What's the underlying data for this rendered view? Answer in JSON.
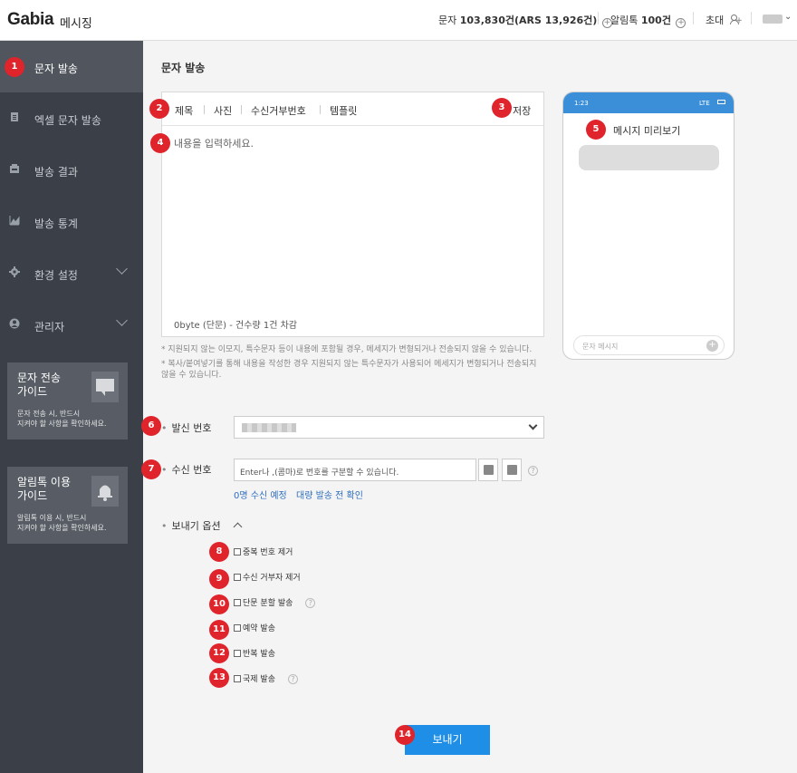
{
  "header": {
    "logo": "Gabia",
    "logo_sub": "메시징",
    "sms_label": "문자",
    "sms_value": "103,830건(ARS 13,926건)",
    "alimtalk_label": "알림톡",
    "alimtalk_value": "100건",
    "invite_label": "초대"
  },
  "sidebar": {
    "items": [
      {
        "label": "문자 발송"
      },
      {
        "label": "엑셀 문자 발송"
      },
      {
        "label": "발송 결과"
      },
      {
        "label": "발송 통계"
      },
      {
        "label": "환경 설정"
      },
      {
        "label": "관리자"
      }
    ],
    "guides": [
      {
        "title": "문자 전송\n가이드",
        "desc": "문자 전송 시, 반드시\n지켜야 할 사항을 확인하세요."
      },
      {
        "title": "알림톡 이용\n가이드",
        "desc": "알림톡 이용 시, 반드시\n지켜야 할 사항을 확인하세요."
      }
    ]
  },
  "main": {
    "page_title": "문자 발송",
    "toolbar": {
      "title": "제목",
      "photo": "사진",
      "reject_number": "수신거부번호",
      "template": "템플릿",
      "save": "저장"
    },
    "content_placeholder": "내용을 입력하세요.",
    "byte_info": "0byte (단문) - 건수량 1건 차감",
    "notes": [
      "*  지원되지 않는 이모지, 특수문자 등이 내용에 포함될 경우, 메세지가 변형되거나 전송되지 않을 수 있습니다.",
      "*  복사/붙여넣기를 통해 내용을 작성한 경우 지원되지 않는 특수문자가 사용되어 메세지가 변형되거나 전송되지 않을 수 있습니다."
    ],
    "preview": {
      "time": "1:23",
      "signal": "LTE",
      "title": "메시지 미리보기",
      "input_placeholder": "문자 메시지"
    },
    "sender": {
      "label": "발신 번호"
    },
    "receiver": {
      "label": "수신 번호",
      "placeholder": "Enter나 ,(콤마)로 번호를 구분할 수 있습니다.",
      "count_text": "0명 수신 예정",
      "bulk_link": "대량 발송 전 확인"
    },
    "options": {
      "title": "보내기 옵션",
      "items": [
        {
          "label": "중복 번호 제거",
          "help": false
        },
        {
          "label": "수신 거부자 제거",
          "help": false
        },
        {
          "label": "단문 분할 발송",
          "help": true
        },
        {
          "label": "예약 발송",
          "help": false
        },
        {
          "label": "반복 발송",
          "help": false
        },
        {
          "label": "국제 발송",
          "help": true
        }
      ]
    },
    "send_button": "보내기"
  },
  "badges": [
    "1",
    "2",
    "3",
    "4",
    "5",
    "6",
    "7",
    "8",
    "9",
    "10",
    "11",
    "12",
    "13",
    "14"
  ],
  "colors": {
    "accent": "#1f8ee6",
    "badge": "#e0242b",
    "sidebar": "#3a3f48",
    "phone_bar": "#3b8fd9"
  },
  "icons": [
    "document-icon",
    "excel-icon",
    "inbox-icon",
    "chart-icon",
    "gear-icon",
    "user-icon",
    "chat-icon",
    "bell-icon",
    "address-book-icon",
    "upload-icon",
    "help-icon",
    "plus-circle-icon",
    "add-user-icon"
  ]
}
